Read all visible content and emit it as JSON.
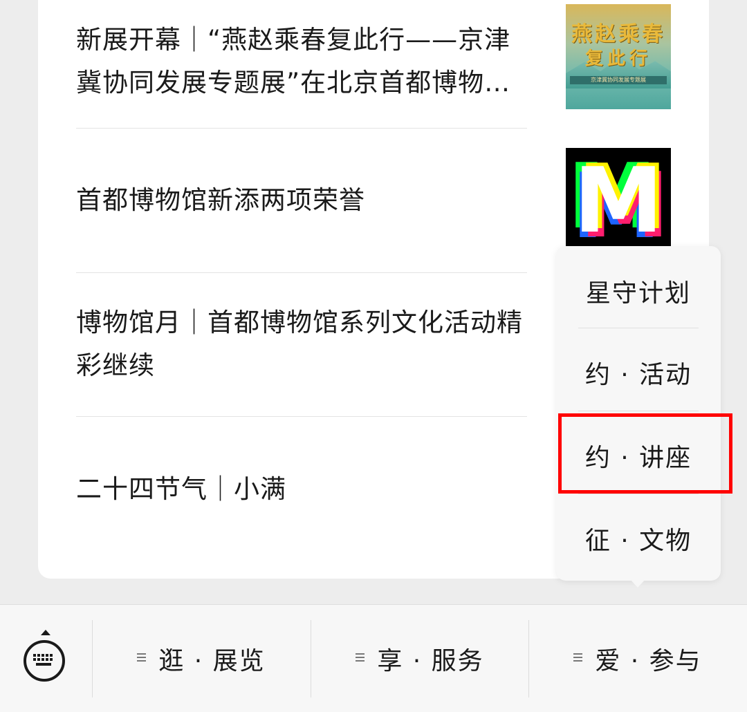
{
  "articles": [
    {
      "title": "新展开幕｜“燕赵乘春复此行——京津冀协同发展专题展”在北京首都博物馆开幕"
    },
    {
      "title": "首都博物馆新添两项荣誉"
    },
    {
      "title": "博物馆月｜首都博物馆系列文化活动精彩继续"
    },
    {
      "title": "二十四节气｜小满"
    }
  ],
  "thumbnails": {
    "exhibit": {
      "calligraphy_line1": "燕赵乘春",
      "calligraphy_line2": "复此行",
      "subtitle": "京津冀协同发展专题展"
    },
    "logo": {
      "letter": "M",
      "colors": [
        "#00ff3c",
        "#ff1e6e",
        "#1e64ff",
        "#fff200",
        "#ffffff"
      ]
    }
  },
  "popup_menu": {
    "items": [
      "星守计划",
      "约 · 活动",
      "约 · 讲座",
      "征 · 文物"
    ],
    "highlighted_index": 2,
    "highlight_color": "#ff0000"
  },
  "tabbar": {
    "keyboard_icon": "keyboard-icon",
    "tabs": [
      {
        "label": "逛 · 展览",
        "icon": "menu-icon"
      },
      {
        "label": "享 · 服务",
        "icon": "menu-icon"
      },
      {
        "label": "爱 · 参与",
        "icon": "menu-icon"
      }
    ]
  }
}
